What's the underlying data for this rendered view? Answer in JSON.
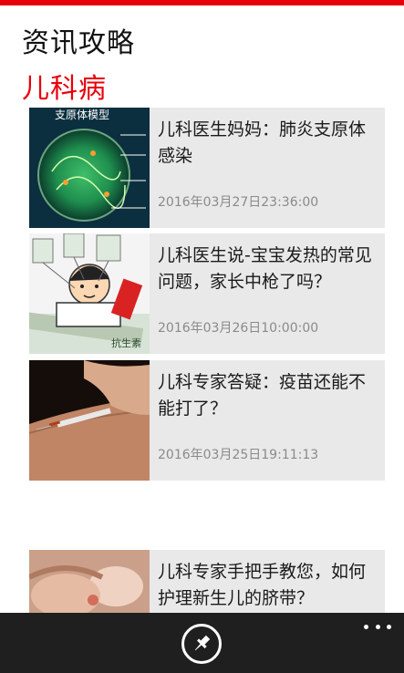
{
  "header": {
    "title": "资讯攻略",
    "section": "儿科病"
  },
  "articles": [
    {
      "title": "儿科医生妈妈：肺炎支原体感染",
      "date": "2016年03月27日23:36:00",
      "image_text": "支原体模型"
    },
    {
      "title": "儿科医生说-宝宝发热的常见问题，家长中枪了吗？",
      "date": "2016年03月26日10:00:00",
      "image_text": "抗生素"
    },
    {
      "title": "儿科专家答疑：疫苗还能不能打了？",
      "date": "2016年03月25日19:11:13"
    },
    {
      "title": "儿科专家手把手教您，如何护理新生儿的脐带？",
      "date": ""
    }
  ],
  "appbar": {
    "pin_icon": "pin-icon",
    "more_icon": "more-icon"
  },
  "colors": {
    "accent": "#e8000b",
    "tile_bg": "#e9e9e9",
    "appbar_bg": "#1f1f1f"
  }
}
